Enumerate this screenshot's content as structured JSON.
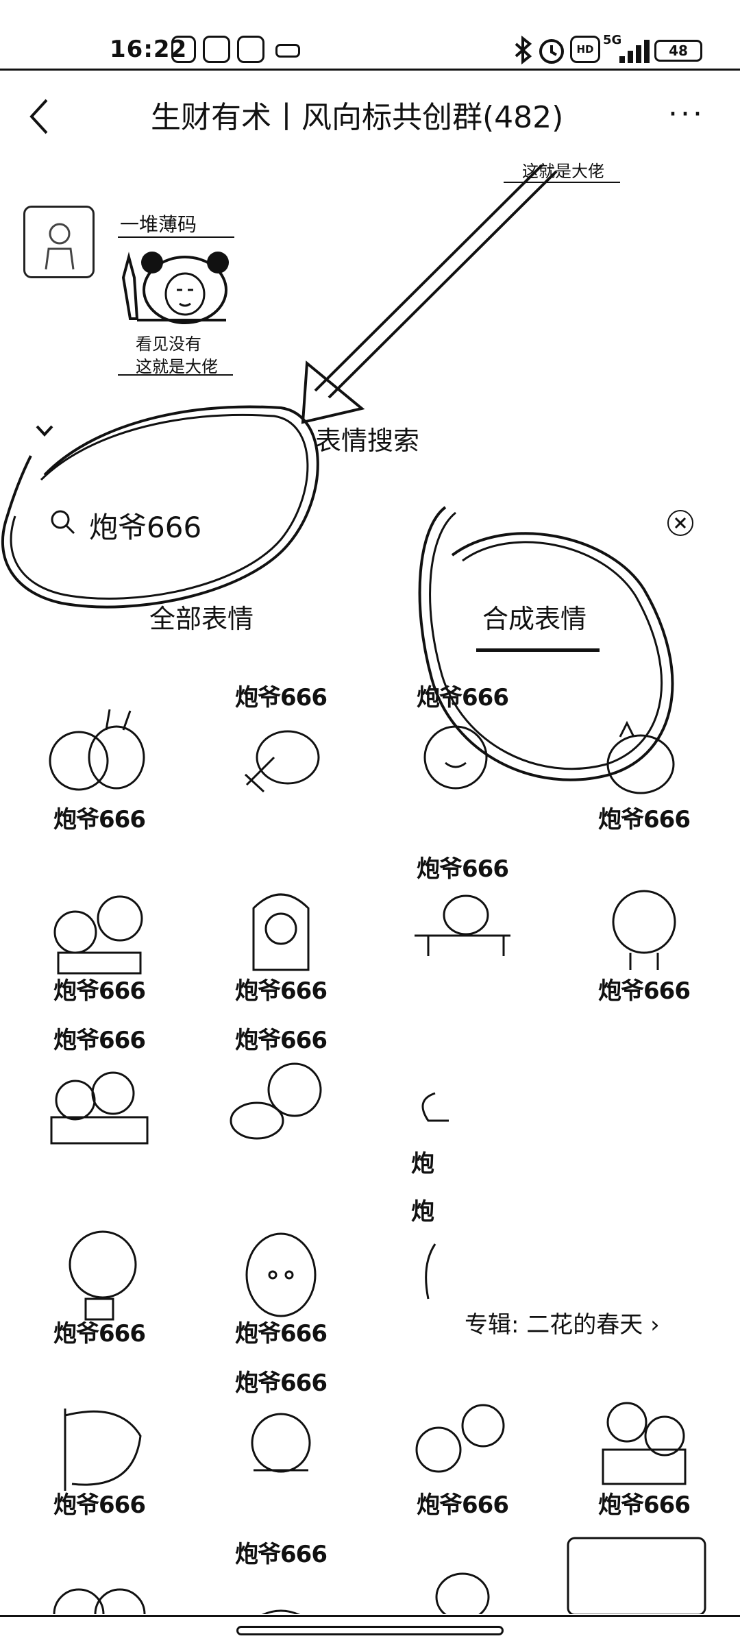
{
  "status_bar": {
    "time": "16:22",
    "network": "5G",
    "hd": "HD",
    "battery": "48"
  },
  "header": {
    "title": "生财有术丨风向标共创群(482)",
    "more": "···"
  },
  "message": {
    "annotation_top": "这就是大佬",
    "sender": "一堆薄码",
    "caption_line1": "看见没有",
    "caption_line2": "这就是大佬"
  },
  "emoji_search": {
    "title": "表情搜索",
    "query": "炮爷666",
    "tab_all": "全部表情",
    "tab_synth": "合成表情",
    "album": "专辑: 二花的春天",
    "stickers": [
      {
        "caption": "炮爷666",
        "pos": "bottom"
      },
      {
        "caption": "炮爷666",
        "pos": "top"
      },
      {
        "caption": "炮爷666",
        "pos": "top"
      },
      {
        "caption": "炮爷666",
        "pos": "bottom"
      },
      {
        "caption": "炮爷666",
        "pos": "bottom"
      },
      {
        "caption": "炮爷666",
        "pos": "bottom"
      },
      {
        "caption": "炮爷666",
        "pos": "top"
      },
      {
        "caption": "炮爷666",
        "pos": "bottom"
      },
      {
        "caption": "炮爷666",
        "pos": "top"
      },
      {
        "caption": "炮爷666",
        "pos": "top"
      },
      {
        "caption": "炮",
        "pos": "bottom"
      },
      {
        "caption": "炮爷666",
        "pos": "bottom"
      },
      {
        "caption": "炮爷666",
        "pos": "bottom"
      },
      {
        "caption": "炮",
        "pos": "top"
      },
      {
        "caption": "炮爷666",
        "pos": "bottom"
      },
      {
        "caption": "炮爷666",
        "pos": "top"
      },
      {
        "caption": "炮爷666",
        "pos": "bottom"
      },
      {
        "caption": "炮爷666",
        "pos": "bottom"
      },
      {
        "caption": "炮爷666",
        "pos": "top"
      }
    ]
  }
}
